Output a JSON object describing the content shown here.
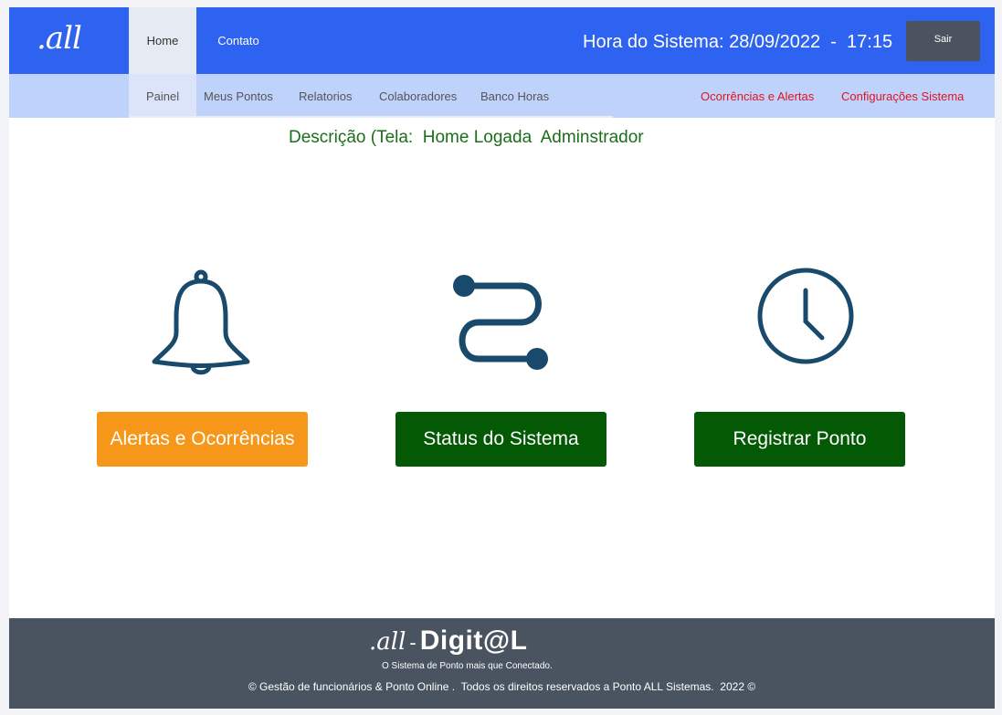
{
  "header": {
    "logo": ".all",
    "nav": {
      "home": "Home",
      "contato": "Contato"
    },
    "system_time": "Hora do Sistema: 28/09/2022  -  17:15",
    "logout": "Sair"
  },
  "subnav": {
    "items": [
      "Painel",
      "Meus Pontos",
      "Relatorios",
      "Colaboradores",
      "Banco Horas"
    ],
    "alerts": "Ocorrências e Alertas",
    "settings": "Configurações Sistema"
  },
  "main": {
    "description": "Descrição (Tela:  Home Logada  Adminstrador",
    "actions": [
      {
        "label": "Alertas e Ocorrências",
        "icon": "bell-icon",
        "color": "#f6971a"
      },
      {
        "label": "Status do Sistema",
        "icon": "route-icon",
        "color": "#045904"
      },
      {
        "label": "Registrar Ponto",
        "icon": "clock-icon",
        "color": "#045904"
      }
    ],
    "icon_color": "#1a4a6b"
  },
  "footer": {
    "logo_all": ".all",
    "logo_dash": "-",
    "logo_digital": "Digit@L",
    "tagline": "O Sistema de Ponto mais que Conectado.",
    "copyright": "© Gestão de funcionários & Ponto Online .  Todos os direitos reservados a Ponto ALL Sistemas.  2022 ©"
  },
  "colors": {
    "topbar": "#2e62f0",
    "subnav": "#bfd2fb",
    "footer": "#4a5360",
    "alert_red": "#e2141c",
    "description_green": "#1b6e1b"
  }
}
